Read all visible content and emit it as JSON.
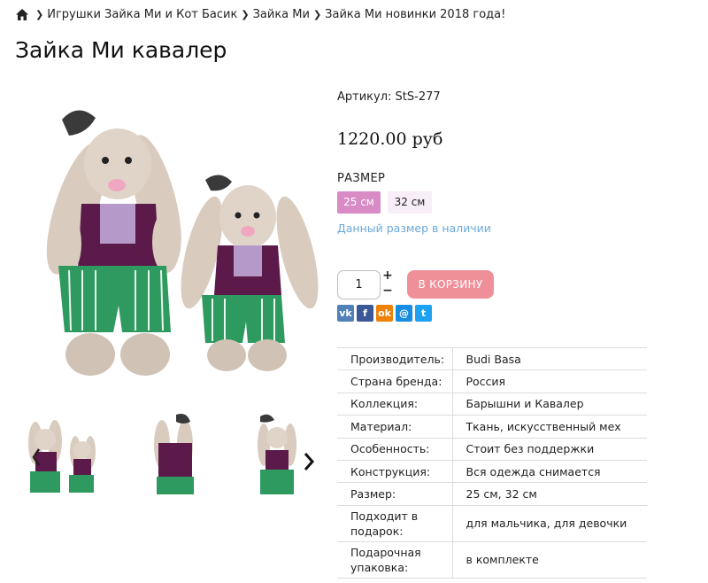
{
  "breadcrumb": {
    "items": [
      "Игрушки Зайка Ми и Кот Басик",
      "Зайка Ми",
      "Зайка Ми новинки 2018 года!"
    ]
  },
  "product": {
    "title": "Зайка Ми кавалер",
    "sku": "Артикул: StS-277",
    "price": "1220.00 руб",
    "size_label": "РАЗМЕР",
    "sizes": [
      "25 см",
      "32 см"
    ],
    "selected_size": "25 см",
    "availability": "Данный размер в наличии",
    "quantity": "1",
    "qty_plus": "+",
    "qty_minus": "−",
    "cart_button": "В КОРЗИНУ"
  },
  "social": {
    "vk": "vk",
    "fb": "f",
    "ok": "ok",
    "mr": "@",
    "tw": "t"
  },
  "specs": [
    {
      "label": "Производитель:",
      "value": "Budi Basa"
    },
    {
      "label": "Страна бренда:",
      "value": "Россия"
    },
    {
      "label": "Коллекция:",
      "value": "Барышни и Кавалер"
    },
    {
      "label": "Материал:",
      "value": "Ткань, искусственный мех"
    },
    {
      "label": "Особенность:",
      "value": "Стоит без поддержки"
    },
    {
      "label": "Конструкция:",
      "value": "Вся одежда снимается"
    },
    {
      "label": "Размер:",
      "value": "25 см, 32 см"
    },
    {
      "label": "Подходит в подарок:",
      "value": "для мальчика, для девочки"
    },
    {
      "label": "Подарочная упаковка:",
      "value": "в комплекте"
    }
  ],
  "colors": {
    "accent_pink": "#d98bc6",
    "cart_pink": "#ef8f98",
    "link_blue": "#6aa8d8",
    "jacket_purple": "#5c1a4a",
    "pants_green": "#2e9a60",
    "fur_beige": "#d9ccbf"
  },
  "icons": [
    "home-icon",
    "chevron-right-icon",
    "chevron-left-icon",
    "vk-icon",
    "facebook-icon",
    "odnoklassniki-icon",
    "moimir-icon",
    "twitter-icon"
  ]
}
